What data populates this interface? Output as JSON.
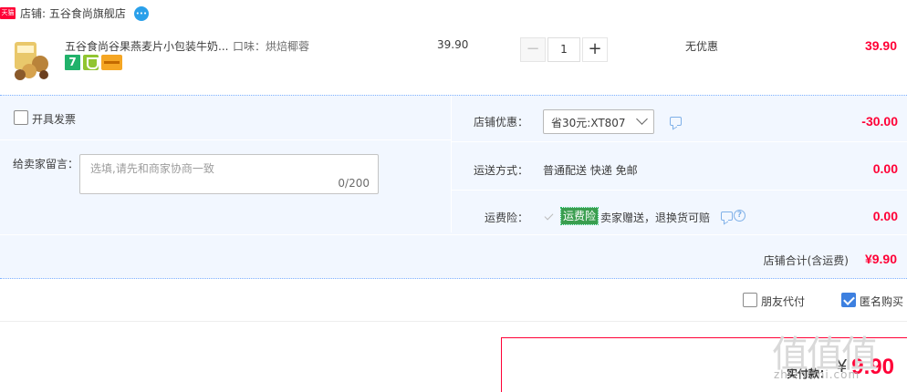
{
  "shop": {
    "badge": "天猫",
    "name": "店铺: 五谷食尚旗舰店",
    "chat_icon": "wangwang-chat-icon"
  },
  "item": {
    "title": "五谷食尚谷果燕麦片小包装牛奶...",
    "sku": "口味：烘焙椰蓉",
    "service_7": "7",
    "unit_price": "39.90",
    "quantity": "1",
    "qty_minus": "−",
    "qty_plus": "+",
    "discount": "无优惠",
    "subtotal": "39.90"
  },
  "invoice": {
    "label": "开具发票",
    "checked": false
  },
  "message": {
    "label": "给卖家留言：",
    "placeholder": "选填,请先和商家协商一致",
    "counter": "0/200"
  },
  "store_coupon": {
    "label": "店铺优惠：",
    "selected": "省30元:XT807",
    "value": "-30.00"
  },
  "shipping": {
    "label": "运送方式：",
    "method": "普通配送 快递 免邮",
    "value": "0.00"
  },
  "insurance": {
    "label": "运费险：",
    "tag": "运费险",
    "desc": "卖家赠送，退换货可赔",
    "value": "0.00"
  },
  "store_total": {
    "label": "店铺合计(含运费)",
    "value": "¥9.90"
  },
  "options": {
    "friend_pay": "朋友代付",
    "anonymous": "匿名购买"
  },
  "payment": {
    "label": "实付款：",
    "currency": "¥",
    "amount": "9.90"
  },
  "watermark": {
    "main": "值值值",
    "sub": "zhizhizhi.com"
  },
  "colors": {
    "accent_red": "#ff0036",
    "panel_bg": "#f2f7ff",
    "check_blue": "#3d80e0",
    "insurance_green": "#3a9e4f"
  }
}
